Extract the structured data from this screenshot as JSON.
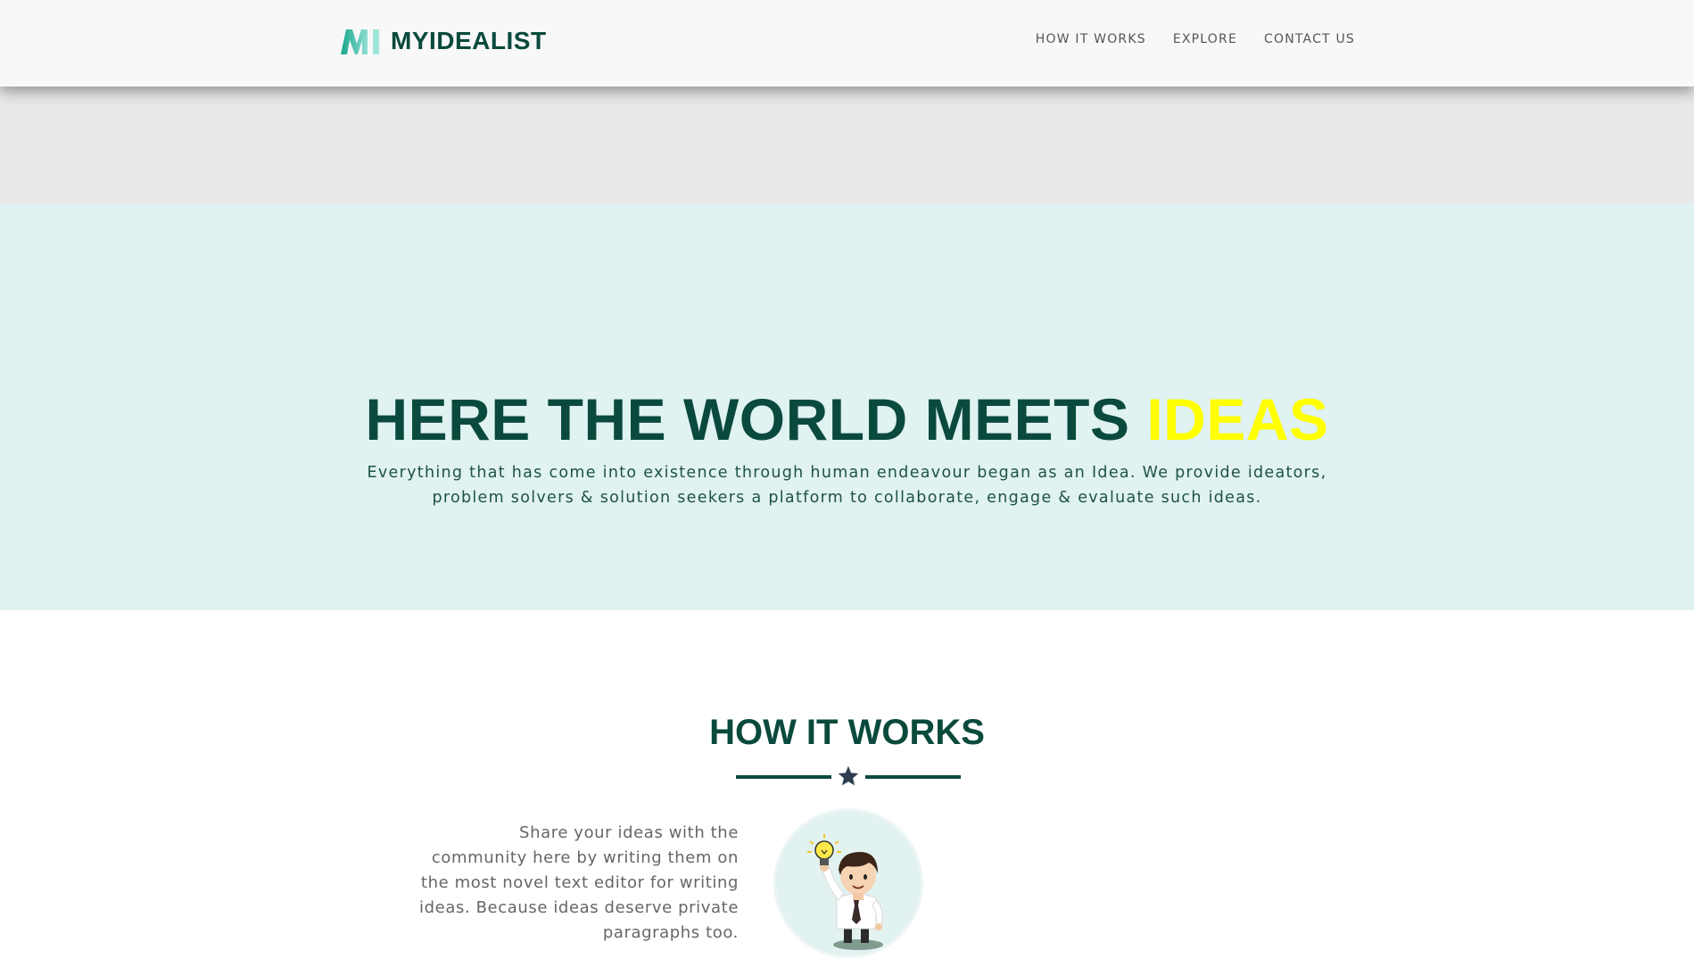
{
  "nav": {
    "logo_text": "MYIDEALIST",
    "links": [
      {
        "label": "HOW IT WORKS"
      },
      {
        "label": "EXPLORE"
      },
      {
        "label": "CONTACT US"
      }
    ]
  },
  "hero": {
    "title_main": "HERE THE WORLD MEETS ",
    "title_accent": "IDEAS",
    "subtitle": "Everything that has come into existence through human endeavour began as an Idea. We provide ideators, problem solvers & solution seekers a platform to collaborate, engage & evaluate such ideas."
  },
  "how_it_works": {
    "title": "HOW IT WORKS",
    "steps": [
      {
        "text": "Share your ideas with the community here by writing them on the most novel text editor for writing ideas. Because ideas deserve private paragraphs too.",
        "illustration": "man-with-lightbulb-icon"
      }
    ]
  },
  "colors": {
    "brand_dark": "#0a4a3c",
    "brand_teal": "#1fb8a0",
    "accent_yellow": "#ffff00",
    "hero_bg": "#e0f2f1",
    "navbar_bg": "#f8f8f8"
  },
  "icons": {
    "logo": "mi-logo-icon",
    "divider": "star-icon"
  }
}
